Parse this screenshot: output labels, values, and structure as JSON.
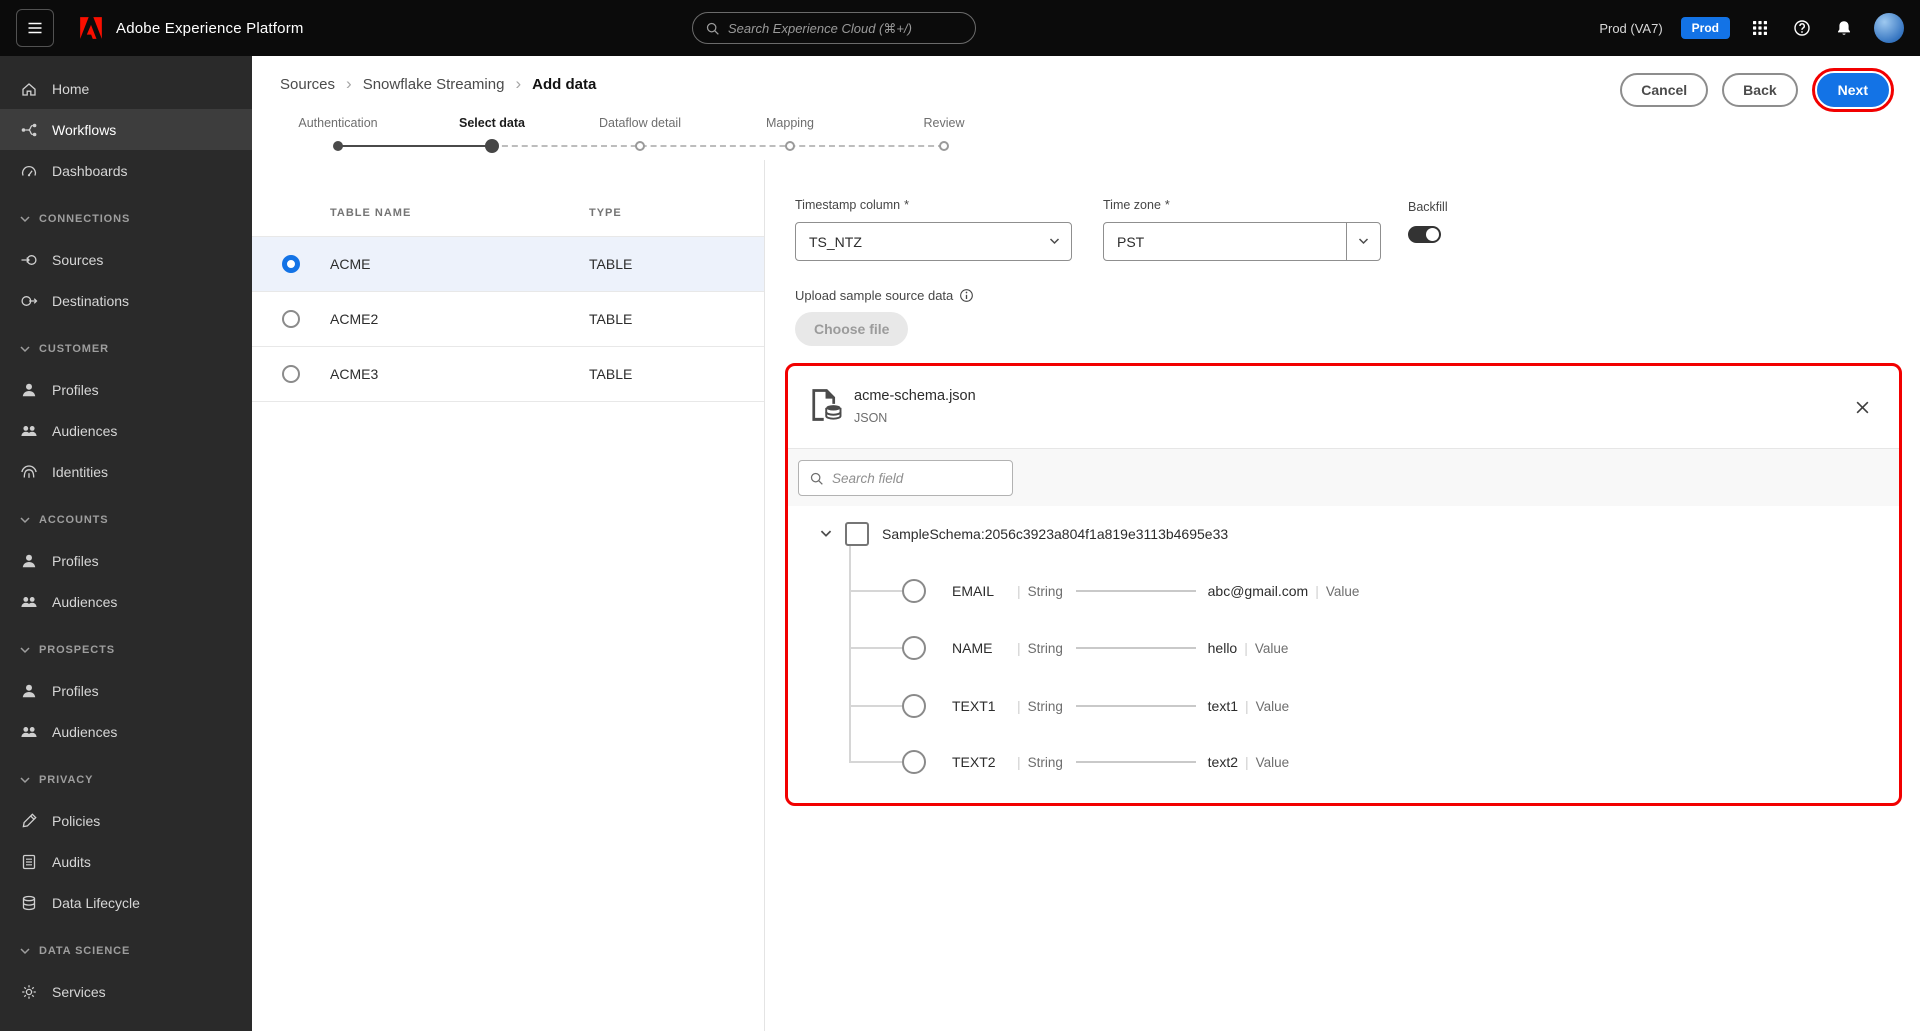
{
  "topbar": {
    "app_title": "Adobe Experience Platform",
    "search_placeholder": "Search Experience Cloud (⌘+/)",
    "org_label": "Prod (VA7)",
    "env_badge": "Prod"
  },
  "sidebar": {
    "selected_item": "Workflows",
    "sections": [
      {
        "items": [
          {
            "label": "Home"
          },
          {
            "label": "Workflows"
          },
          {
            "label": "Dashboards"
          }
        ]
      },
      {
        "header": "CONNECTIONS",
        "items": [
          {
            "label": "Sources"
          },
          {
            "label": "Destinations"
          }
        ]
      },
      {
        "header": "CUSTOMER",
        "items": [
          {
            "label": "Profiles"
          },
          {
            "label": "Audiences"
          },
          {
            "label": "Identities"
          }
        ]
      },
      {
        "header": "ACCOUNTS",
        "items": [
          {
            "label": "Profiles"
          },
          {
            "label": "Audiences"
          }
        ]
      },
      {
        "header": "PROSPECTS",
        "items": [
          {
            "label": "Profiles"
          },
          {
            "label": "Audiences"
          }
        ]
      },
      {
        "header": "PRIVACY",
        "items": [
          {
            "label": "Policies"
          },
          {
            "label": "Audits"
          },
          {
            "label": "Data Lifecycle"
          }
        ]
      },
      {
        "header": "DATA SCIENCE",
        "items": [
          {
            "label": "Services"
          }
        ]
      }
    ]
  },
  "breadcrumb": {
    "items": [
      "Sources",
      "Snowflake Streaming",
      "Add data"
    ]
  },
  "header_actions": {
    "cancel": "Cancel",
    "back": "Back",
    "next": "Next"
  },
  "steps": {
    "items": [
      {
        "label": "Authentication",
        "state": "done"
      },
      {
        "label": "Select data",
        "state": "active"
      },
      {
        "label": "Dataflow detail",
        "state": "upcoming"
      },
      {
        "label": "Mapping",
        "state": "upcoming"
      },
      {
        "label": "Review",
        "state": "upcoming"
      }
    ]
  },
  "table": {
    "columns": [
      "TABLE NAME",
      "TYPE"
    ],
    "rows": [
      {
        "name": "ACME",
        "type": "TABLE",
        "selected": true
      },
      {
        "name": "ACME2",
        "type": "TABLE",
        "selected": false
      },
      {
        "name": "ACME3",
        "type": "TABLE",
        "selected": false
      }
    ]
  },
  "form": {
    "timestamp": {
      "label": "Timestamp column",
      "required": "*",
      "value": "TS_NTZ"
    },
    "timezone": {
      "label": "Time zone",
      "required": "*",
      "value": "PST"
    },
    "backfill": {
      "label": "Backfill",
      "on": true
    },
    "upload": {
      "label": "Upload sample source data",
      "button": "Choose file"
    }
  },
  "schema_panel": {
    "file_name": "acme-schema.json",
    "file_type": "JSON",
    "search_placeholder": "Search field",
    "root_label": "SampleSchema:2056c3923a804f1a819e3113b4695e33",
    "fields": [
      {
        "name": "EMAIL",
        "type": "String",
        "value": "abc@gmail.com",
        "value_label": "Value"
      },
      {
        "name": "NAME",
        "type": "String",
        "value": "hello",
        "value_label": "Value"
      },
      {
        "name": "TEXT1",
        "type": "String",
        "value": "text1",
        "value_label": "Value"
      },
      {
        "name": "TEXT2",
        "type": "String",
        "value": "text2",
        "value_label": "Value"
      }
    ]
  }
}
